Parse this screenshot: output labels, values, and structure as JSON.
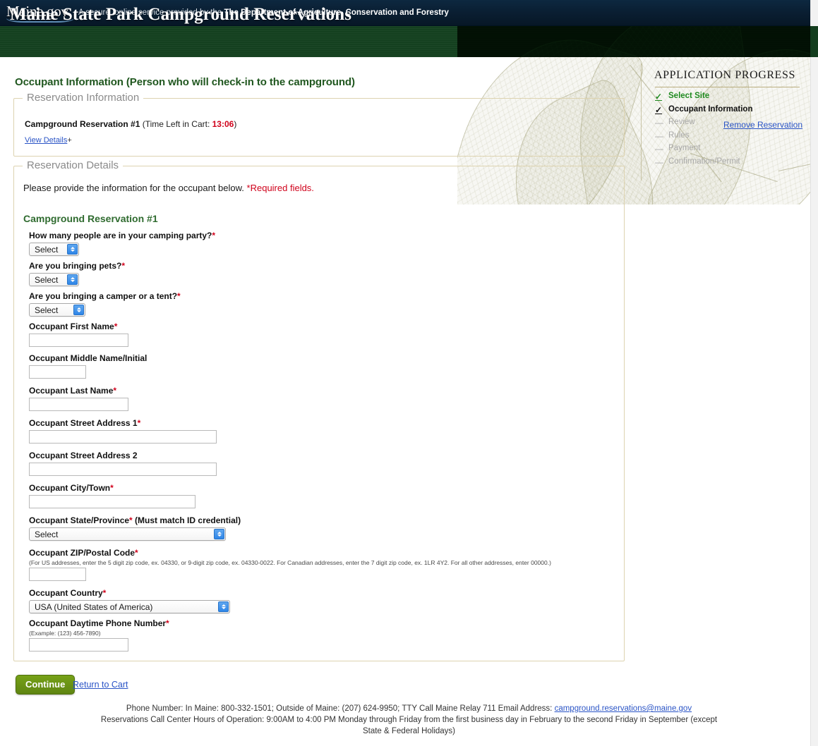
{
  "topbar": {
    "logo_text": "Maine.gov",
    "tagline_prefix": "A secure, online service provided by the ",
    "tagline_bold": "The Department of Agriculture, Conservation and Forestry"
  },
  "banner": {
    "site_title": "Maine State Park Campground Reservations"
  },
  "page": {
    "heading": "Occupant Information (Person who will check-in to the campground)"
  },
  "reservation_info": {
    "legend": "Reservation Information",
    "title": "Campground Reservation #1",
    "timer_prefix": " (Time Left in Cart: ",
    "timer_value": "13:06",
    "timer_suffix": ")",
    "view_details": "View Details",
    "view_details_plus": "+",
    "remove_reservation": "Remove Reservation"
  },
  "reservation_details": {
    "legend": "Reservation Details",
    "intro": "Please provide the information for the occupant below. ",
    "intro_required": "*Required fields.",
    "sub_heading": "Campground Reservation #1",
    "fields": [
      {
        "label": "How many people are in your camping party?",
        "required": true,
        "type": "select",
        "value": "Select",
        "hint": ""
      },
      {
        "label": "Are you bringing pets?",
        "required": true,
        "type": "select",
        "value": "Select",
        "hint": ""
      },
      {
        "label": "Are you bringing a camper or a tent?",
        "required": true,
        "type": "select",
        "value": "Select",
        "hint": ""
      },
      {
        "label": "Occupant First Name",
        "required": true,
        "type": "text",
        "value": "",
        "hint": ""
      },
      {
        "label": "Occupant Middle Name/Initial",
        "required": false,
        "type": "text",
        "value": "",
        "hint": ""
      },
      {
        "label": "Occupant Last Name",
        "required": true,
        "type": "text",
        "value": "",
        "hint": ""
      },
      {
        "label": "Occupant Street Address 1",
        "required": true,
        "type": "text",
        "value": "",
        "hint": ""
      },
      {
        "label": "Occupant Street Address 2",
        "required": false,
        "type": "text",
        "value": "",
        "hint": ""
      },
      {
        "label": "Occupant City/Town",
        "required": true,
        "type": "text",
        "value": "",
        "hint": ""
      },
      {
        "label": "Occupant State/Province",
        "required": true,
        "suffix": " (Must match ID credential)",
        "type": "select",
        "value": "Select",
        "hint": ""
      },
      {
        "label": "Occupant ZIP/Postal Code",
        "required": true,
        "type": "text",
        "value": "",
        "hint": "(For US addresses, enter the 5 digit zip code, ex. 04330, or 9-digit zip code, ex. 04330-0022. For Canadian addresses, enter the 7 digit zip code, ex. 1LR 4Y2. For all other addresses, enter 00000.)"
      },
      {
        "label": "Occupant Country",
        "required": true,
        "type": "select",
        "value": "USA (United States of America)",
        "hint": ""
      },
      {
        "label": "Occupant Daytime Phone Number",
        "required": true,
        "type": "text",
        "value": "",
        "hint": "(Example: (123) 456-7890)"
      }
    ]
  },
  "progress": {
    "title": "APPLICATION PROGRESS",
    "items": [
      {
        "label": "Select Site",
        "mark": "✓",
        "state": "done-green"
      },
      {
        "label": "Occupant Information",
        "mark": "✓",
        "state": "done-dark"
      },
      {
        "label": "Review",
        "mark": "—",
        "state": "todo"
      },
      {
        "label": "Rules",
        "mark": "—",
        "state": "todo"
      },
      {
        "label": "Payment",
        "mark": "—",
        "state": "todo"
      },
      {
        "label": "Confirmation/Permit",
        "mark": "—",
        "state": "todo"
      }
    ]
  },
  "actions": {
    "continue_label": "Continue",
    "return_to_cart": "Return to Cart"
  },
  "footer": {
    "line1_a": "Phone Number: In Maine: 800-332-1501; Outside of Maine: (207) 624-9950; TTY Call Maine Relay 711 Email Address: ",
    "line1_email": "campground.reservations@maine.gov",
    "line2": "Reservations Call Center Hours of Operation: 9:00AM to 4:00 PM Monday through Friday from the first business day in February to the second Friday in September (except",
    "line3": "State & Federal Holidays)"
  },
  "colors": {
    "brand_green": "#14401f",
    "heading_green": "#20571f",
    "accent_green": "#2f6b2f",
    "link_blue": "#2a54c6",
    "required_red": "#d0021b",
    "button_green": "#76a117",
    "topbar_navy": "#0a1f33",
    "fieldset_border": "#ddd3b0"
  }
}
